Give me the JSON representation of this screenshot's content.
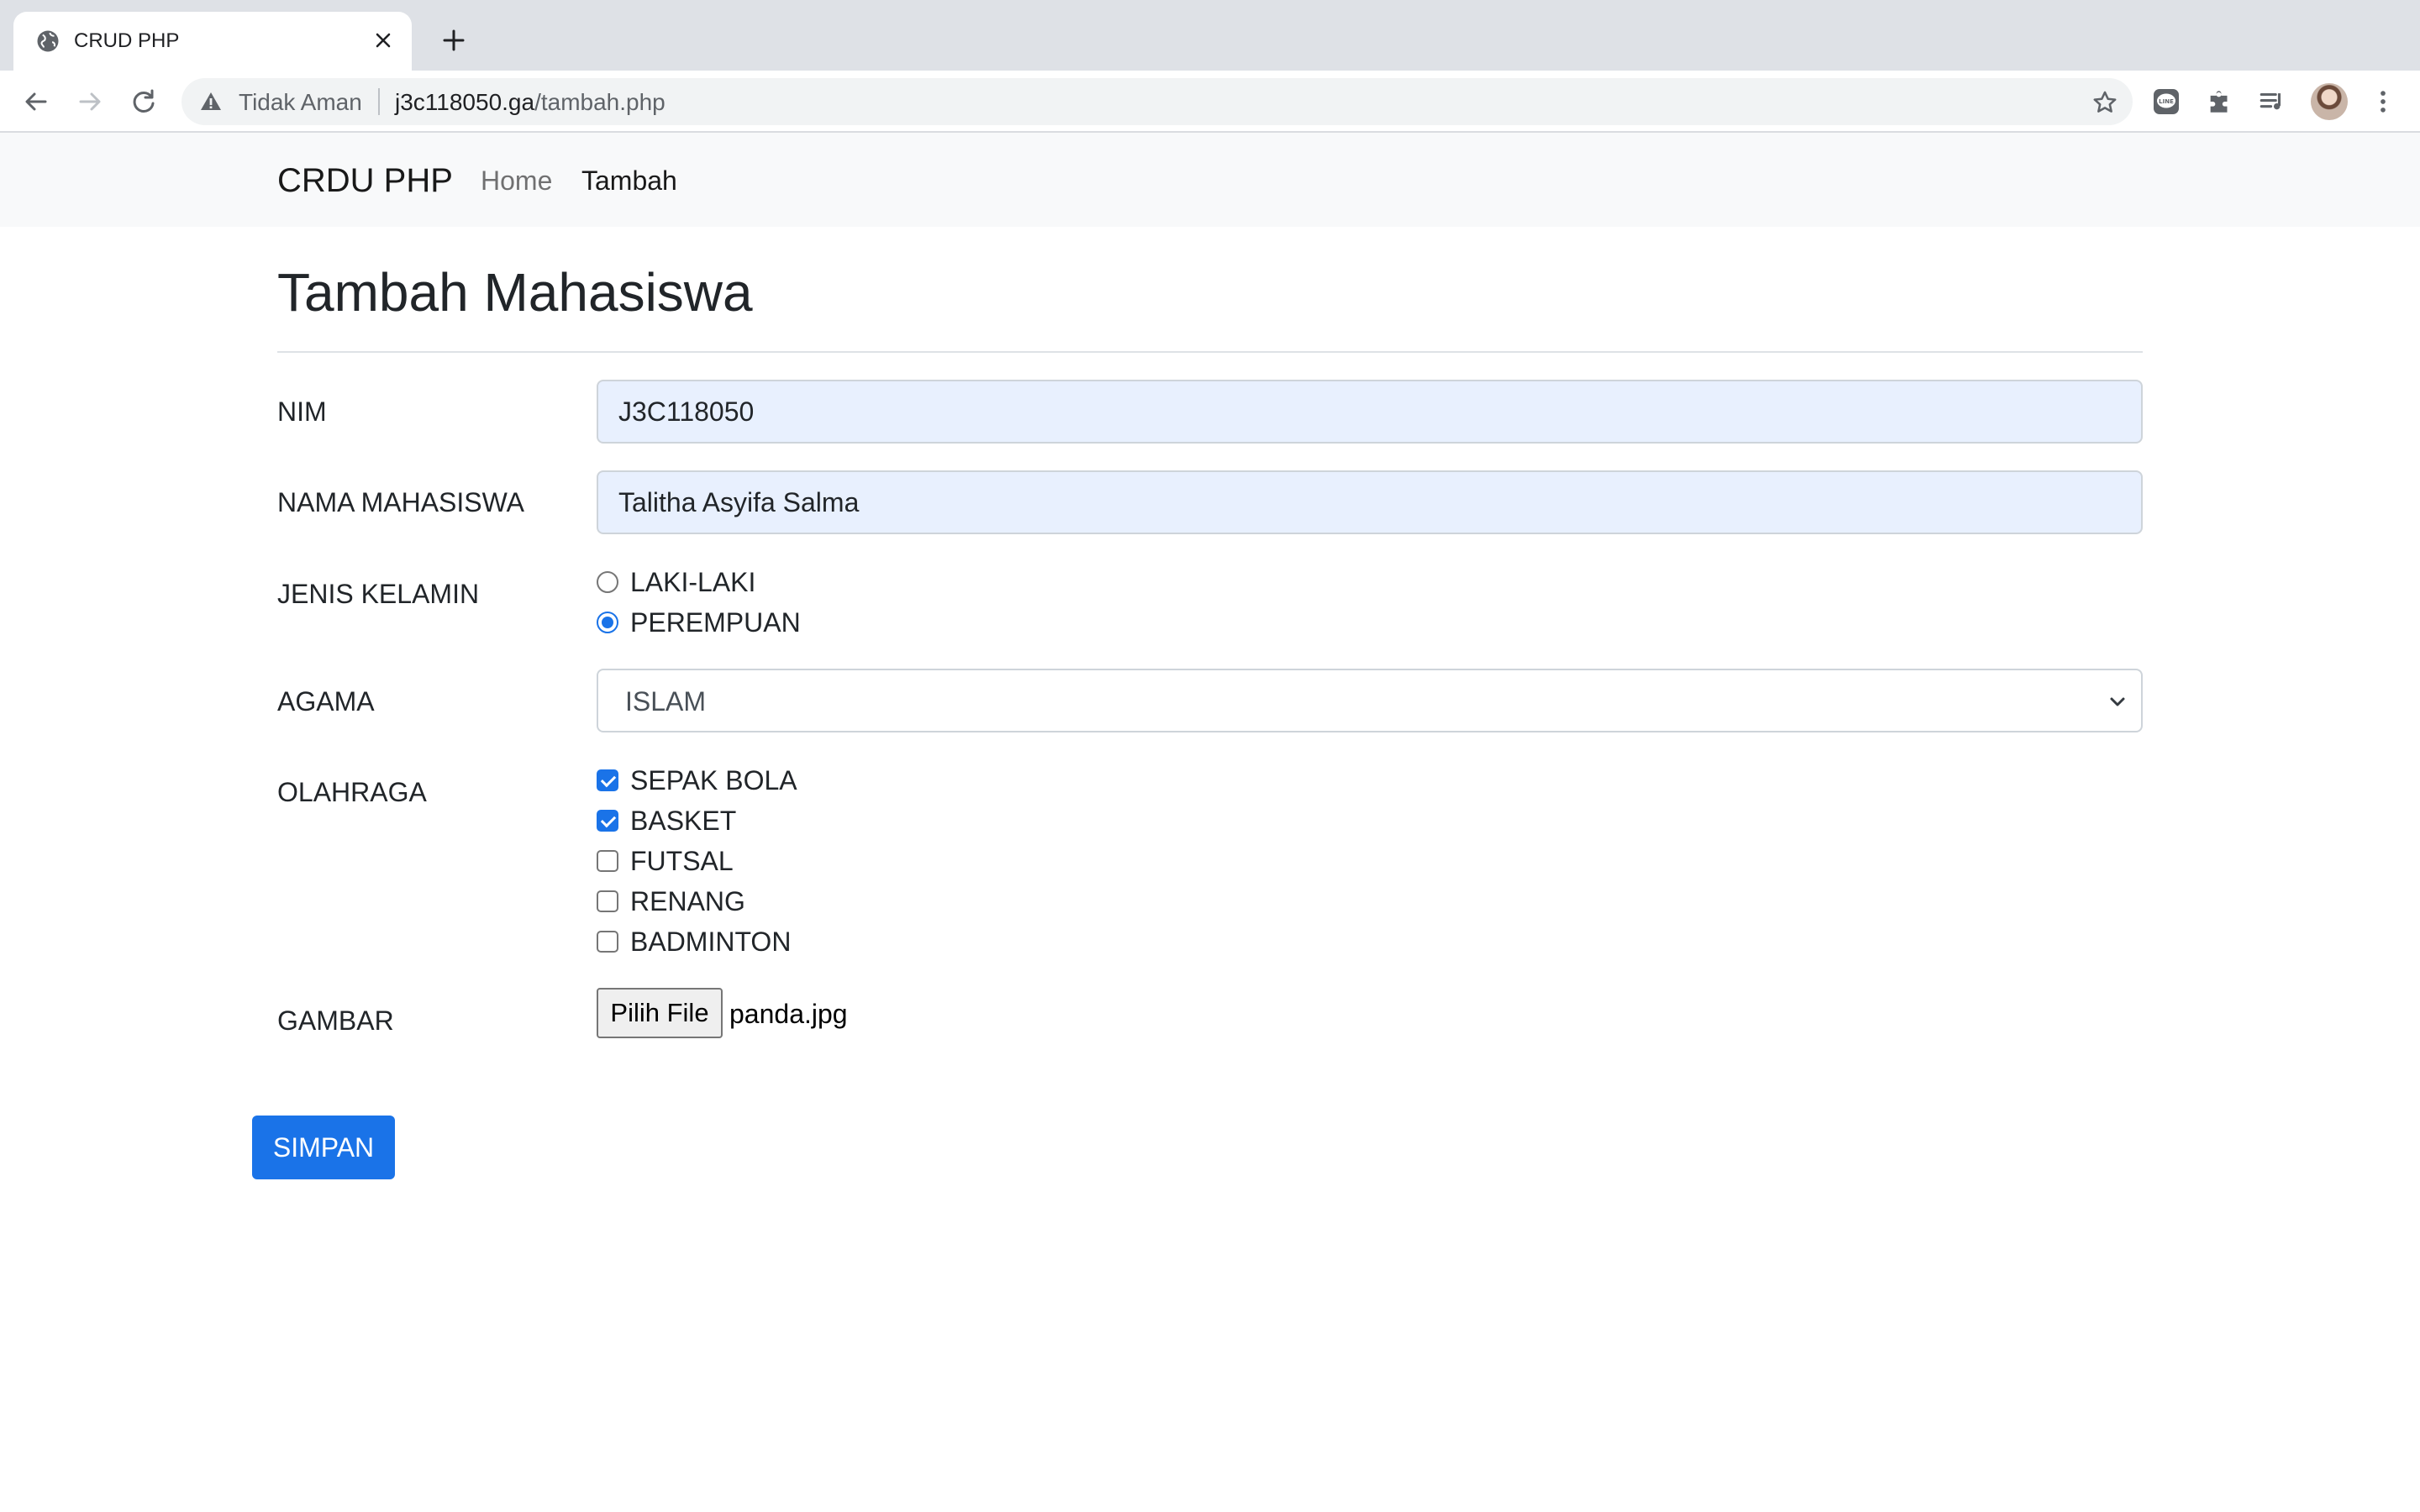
{
  "browser": {
    "tab_title": "CRUD PHP",
    "security_label": "Tidak Aman",
    "url_host": "j3c118050.ga",
    "url_path": "/tambah.php"
  },
  "navbar": {
    "brand": "CRDU PHP",
    "links": [
      {
        "label": "Home",
        "active": false
      },
      {
        "label": "Tambah",
        "active": true
      }
    ]
  },
  "page": {
    "title": "Tambah Mahasiswa"
  },
  "form": {
    "nim": {
      "label": "NIM",
      "value": "J3C118050"
    },
    "nama": {
      "label": "NAMA MAHASISWA",
      "value": "Talitha Asyifa Salma"
    },
    "jenis_kelamin": {
      "label": "JENIS KELAMIN",
      "options": [
        {
          "label": "LAKI-LAKI",
          "checked": false
        },
        {
          "label": "PEREMPUAN",
          "checked": true
        }
      ]
    },
    "agama": {
      "label": "AGAMA",
      "selected": "ISLAM"
    },
    "olahraga": {
      "label": "OLAHRAGA",
      "options": [
        {
          "label": "SEPAK BOLA",
          "checked": true
        },
        {
          "label": "BASKET",
          "checked": true
        },
        {
          "label": "FUTSAL",
          "checked": false
        },
        {
          "label": "RENANG",
          "checked": false
        },
        {
          "label": "BADMINTON",
          "checked": false
        }
      ]
    },
    "gambar": {
      "label": "GAMBAR",
      "button_label": "Pilih File",
      "file_name": "panda.jpg"
    },
    "submit_label": "SIMPAN"
  },
  "colors": {
    "accent": "#1a73e8",
    "autofill_bg": "#e8f0fe",
    "navbar_bg": "#f8f9fa"
  }
}
